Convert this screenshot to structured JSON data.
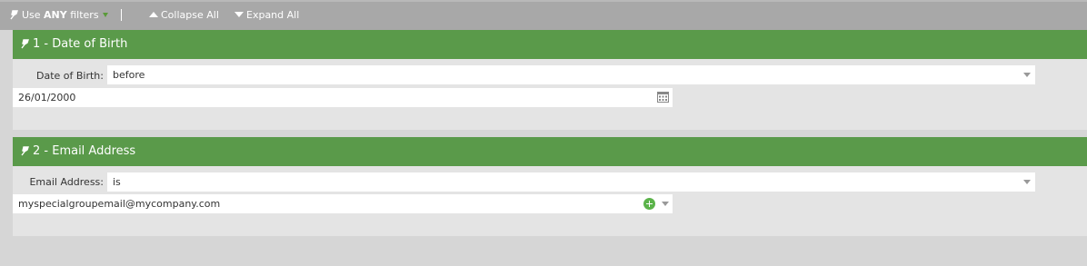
{
  "toolbar": {
    "filter_prefix": "Use ",
    "filter_mode": "ANY",
    "filter_suffix": " filters",
    "separator": "|",
    "collapse_label": "Collapse All",
    "expand_label": "Expand All"
  },
  "filters": [
    {
      "title": "1 - Date of Birth",
      "field_label": "Date of Birth:",
      "operator": "before",
      "value": "26/01/2000",
      "value_icon": "calendar-icon"
    },
    {
      "title": "2 - Email Address",
      "field_label": "Email Address:",
      "operator": "is",
      "value": "myspecialgroupemail@mycompany.com",
      "value_icon": "add-icon"
    }
  ],
  "colors": {
    "header_green": "#5a9a4a",
    "toolbar_gray": "#a8a8a8",
    "panel_gray": "#e4e4e4"
  }
}
